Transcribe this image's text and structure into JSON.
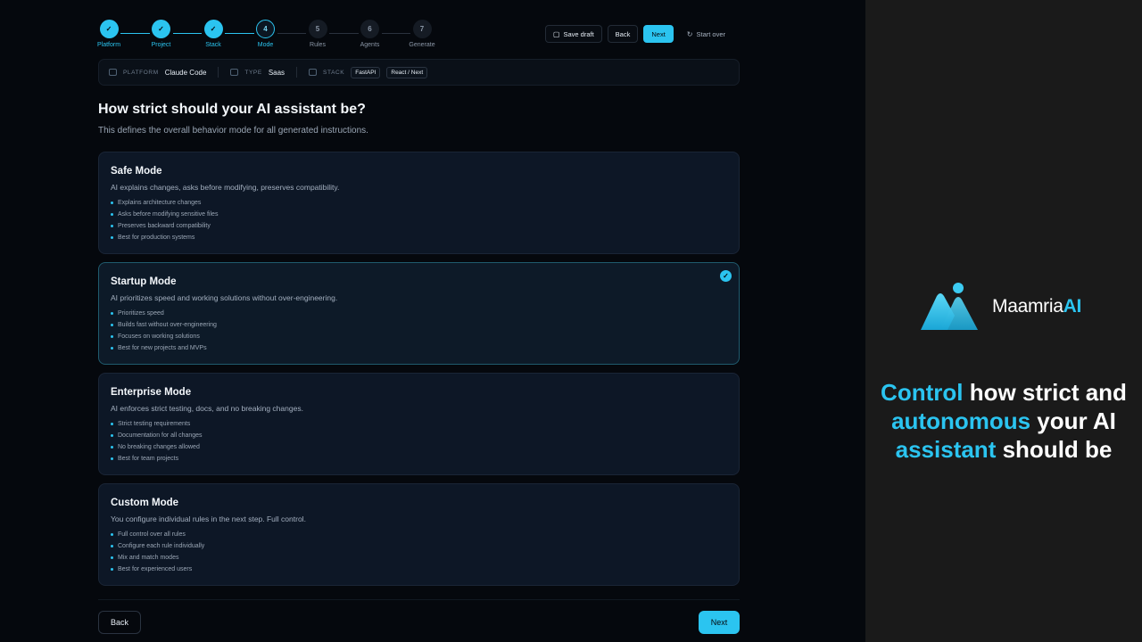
{
  "stepper": {
    "steps": [
      {
        "num": "1",
        "label": "Platform",
        "state": "done"
      },
      {
        "num": "2",
        "label": "Project",
        "state": "done"
      },
      {
        "num": "3",
        "label": "Stack",
        "state": "done"
      },
      {
        "num": "4",
        "label": "Mode",
        "state": "current"
      },
      {
        "num": "5",
        "label": "Rules",
        "state": "todo"
      },
      {
        "num": "6",
        "label": "Agents",
        "state": "todo"
      },
      {
        "num": "7",
        "label": "Generate",
        "state": "todo"
      }
    ]
  },
  "toolbar": {
    "save_draft": "Save draft",
    "back": "Back",
    "next": "Next",
    "start_over": "Start over"
  },
  "context": {
    "platform_key": "PLATFORM",
    "platform_val": "Claude Code",
    "type_key": "TYPE",
    "type_val": "Saas",
    "stack_key": "STACK",
    "stack_chips": [
      "FastAPI",
      "React / Next"
    ]
  },
  "heading": {
    "title": "How strict should your AI assistant be?",
    "subtitle": "This defines the overall behavior mode for all generated instructions."
  },
  "modes": [
    {
      "title": "Safe Mode",
      "desc": "AI explains changes, asks before modifying, preserves compatibility.",
      "bullets": [
        "Explains architecture changes",
        "Asks before modifying sensitive files",
        "Preserves backward compatibility",
        "Best for production systems"
      ],
      "selected": false
    },
    {
      "title": "Startup Mode",
      "desc": "AI prioritizes speed and working solutions without over-engineering.",
      "bullets": [
        "Prioritizes speed",
        "Builds fast without over-engineering",
        "Focuses on working solutions",
        "Best for new projects and MVPs"
      ],
      "selected": true
    },
    {
      "title": "Enterprise Mode",
      "desc": "AI enforces strict testing, docs, and no breaking changes.",
      "bullets": [
        "Strict testing requirements",
        "Documentation for all changes",
        "No breaking changes allowed",
        "Best for team projects"
      ],
      "selected": false
    },
    {
      "title": "Custom Mode",
      "desc": "You configure individual rules in the next step. Full control.",
      "bullets": [
        "Full control over all rules",
        "Configure each rule individually",
        "Mix and match modes",
        "Best for experienced users"
      ],
      "selected": false
    }
  ],
  "footer": {
    "back": "Back",
    "next": "Next"
  },
  "promo": {
    "logo_main": "Maamria",
    "logo_accent": "AI",
    "tagline_parts": [
      {
        "text": "Control",
        "hl": true
      },
      {
        "text": " how strict and ",
        "hl": false
      },
      {
        "text": "autonomous",
        "hl": true
      },
      {
        "text": " your AI ",
        "hl": false
      },
      {
        "text": "assistant",
        "hl": true
      },
      {
        "text": " should be",
        "hl": false
      }
    ]
  },
  "colors": {
    "accent": "#2bc4f0",
    "background": "#05080d",
    "card": "#0d1726",
    "promo_bg": "#1a1a1a"
  },
  "icons": {
    "done_step": "check-icon",
    "selected_card": "check-circle-icon",
    "save_draft": "document-icon",
    "start_over": "refresh-icon",
    "context": "folder-icon"
  }
}
